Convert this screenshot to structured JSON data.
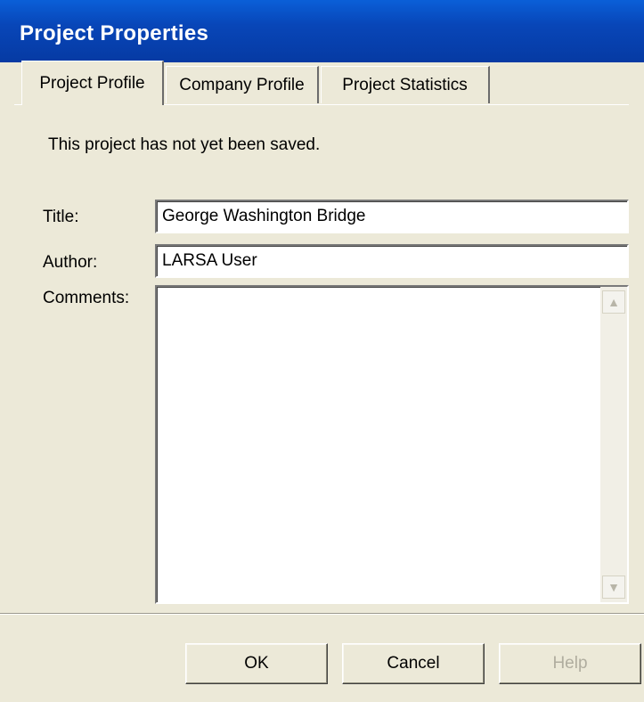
{
  "window": {
    "title": "Project Properties"
  },
  "tabs": [
    {
      "label": "Project Profile",
      "active": true
    },
    {
      "label": "Company Profile",
      "active": false
    },
    {
      "label": "Project Statistics",
      "active": false
    }
  ],
  "profile": {
    "status_message": "This project has not yet been saved.",
    "title_label": "Title:",
    "title_value": "George Washington Bridge",
    "author_label": "Author:",
    "author_value": "LARSA User",
    "comments_label": "Comments:",
    "comments_value": ""
  },
  "buttons": {
    "ok": "OK",
    "cancel": "Cancel",
    "help": "Help"
  },
  "colors": {
    "titlebar": "#0846b8",
    "dialog_bg": "#ece9d8"
  },
  "icons": {
    "scroll_up": "chevron-up-icon",
    "scroll_down": "chevron-down-icon"
  }
}
